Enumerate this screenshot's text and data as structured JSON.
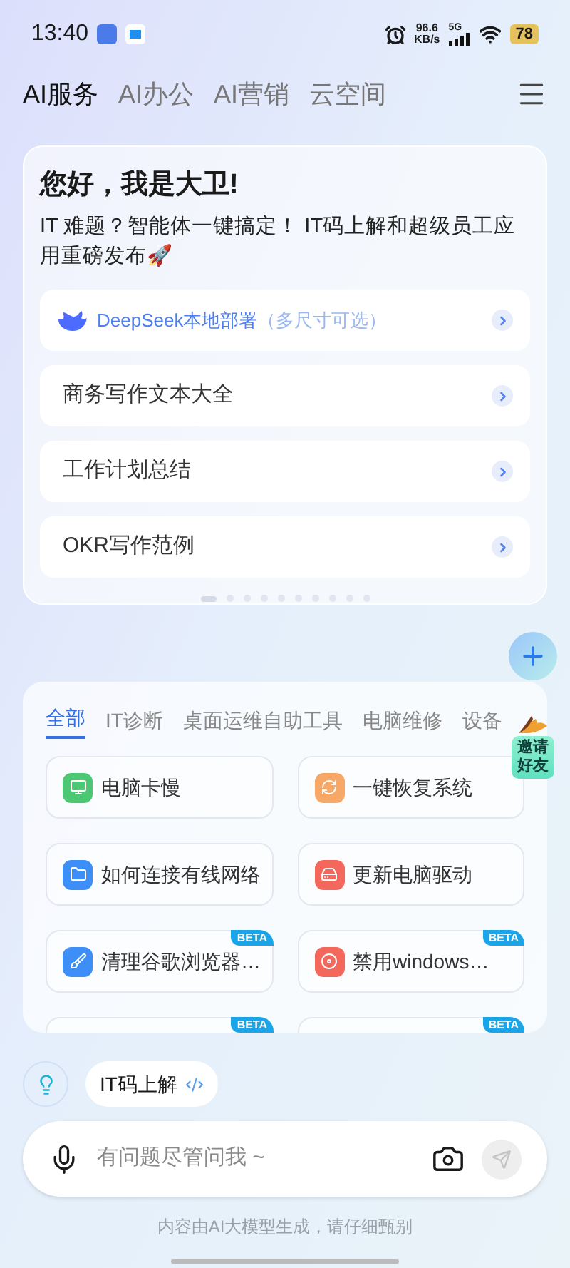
{
  "status_bar": {
    "time": "13:40",
    "speed": "96.6",
    "speed_unit": "KB/s",
    "network": "5G",
    "battery": "78"
  },
  "tabs": [
    {
      "label": "AI服务",
      "selected": true
    },
    {
      "label": "AI办公",
      "selected": false
    },
    {
      "label": "AI营销",
      "selected": false
    },
    {
      "label": "云空间",
      "selected": false
    }
  ],
  "welcome": {
    "title": "您好，我是大卫!",
    "subtitle": "IT 难题？智能体一键搞定！ IT码上解和超级员工应用重磅发布🚀",
    "links": [
      {
        "kind": "featured",
        "label": "DeepSeek本地部署",
        "note": "（多尺寸可选）"
      },
      {
        "kind": "plain",
        "label": "商务写作文本大全"
      },
      {
        "kind": "plain",
        "label": "工作计划总结"
      },
      {
        "kind": "plain",
        "label": "OKR写作范例"
      }
    ],
    "pager": [
      {
        "selected": true
      },
      {
        "selected": false
      },
      {
        "selected": false
      },
      {
        "selected": false
      },
      {
        "selected": false
      },
      {
        "selected": false
      },
      {
        "selected": false
      },
      {
        "selected": false
      },
      {
        "selected": false
      },
      {
        "selected": false
      }
    ]
  },
  "tools": {
    "tabs": [
      {
        "label": "全部",
        "selected": true
      },
      {
        "label": "IT诊断",
        "selected": false
      },
      {
        "label": "桌面运维自助工具",
        "selected": false
      },
      {
        "label": "电脑维修",
        "selected": false
      },
      {
        "label": "设备",
        "selected": false
      }
    ],
    "items": [
      {
        "label": "电脑卡慢",
        "color": "#4cc774"
      },
      {
        "label": "一键恢复系统",
        "color": "#f7a866"
      },
      {
        "label": "如何连接有线网络",
        "color": "#3d8ef7"
      },
      {
        "label": "更新电脑驱动",
        "color": "#f4675c"
      },
      {
        "label": "清理谷歌浏览器…",
        "color": "#3d8ef7",
        "badge": "BETA"
      },
      {
        "label": "禁用windows…",
        "color": "#f4675c",
        "badge": "BETA"
      },
      {
        "badge": "BETA"
      },
      {
        "badge": "BETA"
      }
    ]
  },
  "invite": {
    "label": "邀请好友"
  },
  "quick_chip": {
    "label": "IT码上解"
  },
  "input": {
    "placeholder": "有问题尽管问我 ~"
  },
  "footer": "内容由AI大模型生成，请仔细甄别"
}
